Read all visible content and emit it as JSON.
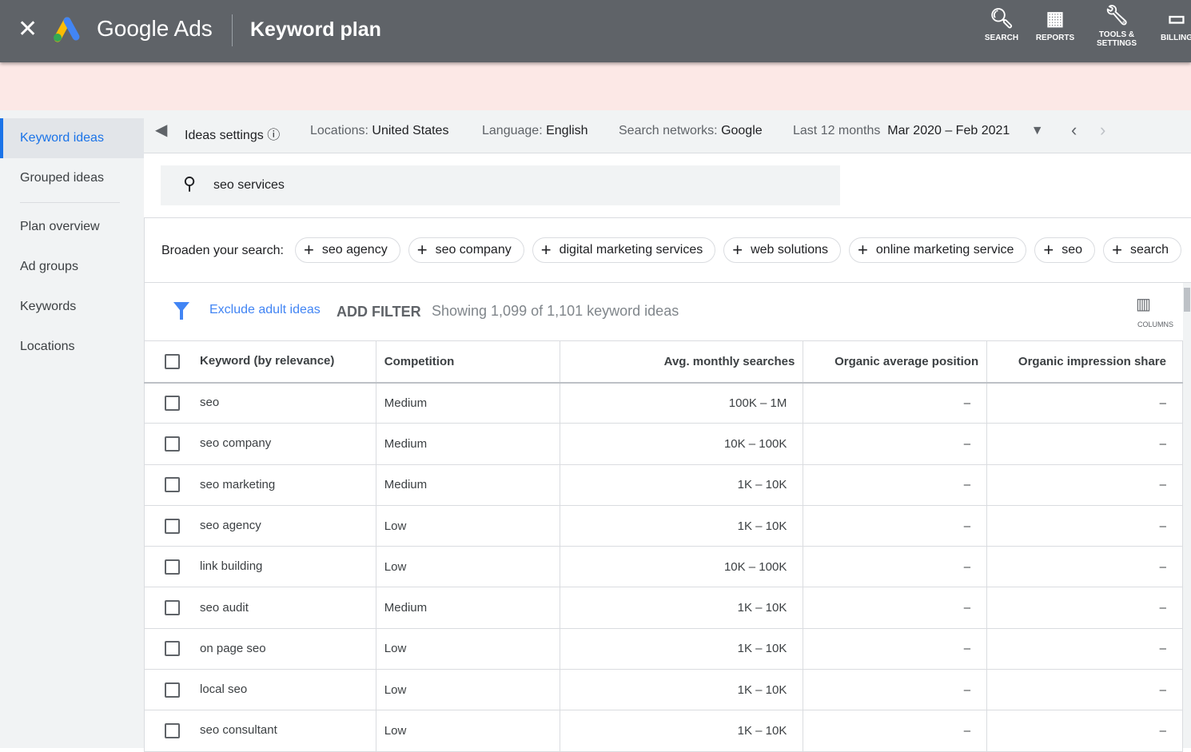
{
  "header": {
    "brand": "Google Ads",
    "title": "Keyword plan",
    "nav": [
      {
        "label": "SEARCH",
        "icon": "search-icon"
      },
      {
        "label": "REPORTS",
        "icon": "reports-icon"
      },
      {
        "label": "TOOLS & SETTINGS",
        "icon": "wrench-icon"
      },
      {
        "label": "BILLING",
        "icon": "credit-card-icon"
      }
    ]
  },
  "sidebar": {
    "items": [
      {
        "label": "Keyword ideas",
        "active": true
      },
      {
        "label": "Grouped ideas"
      },
      {
        "label": "Plan overview"
      },
      {
        "label": "Ad groups"
      },
      {
        "label": "Keywords"
      },
      {
        "label": "Locations"
      }
    ]
  },
  "settings": {
    "ideas": "Ideas settings",
    "locations_label": "Locations:",
    "locations": "United States",
    "language_label": "Language:",
    "language": "English",
    "networks_label": "Search networks:",
    "networks": "Google",
    "period_label": "Last 12 months",
    "period": "Mar 2020 – Feb 2021"
  },
  "search": {
    "value": "seo services"
  },
  "broaden": {
    "label": "Broaden your search:",
    "chips": [
      "seo agency",
      "seo company",
      "digital marketing services",
      "web solutions",
      "online marketing service",
      "seo",
      "search"
    ]
  },
  "filter": {
    "exclude": "Exclude adult ideas",
    "add": "ADD FILTER",
    "showing": "Showing 1,099 of 1,101 keyword ideas",
    "columns": "COLUMNS"
  },
  "table": {
    "headers": [
      "Keyword (by relevance)",
      "Competition",
      "Avg. monthly searches",
      "Organic average position",
      "Organic impression share"
    ],
    "rows": [
      [
        "seo",
        "Medium",
        "100K – 1M",
        "–",
        "–"
      ],
      [
        "seo company",
        "Medium",
        "10K – 100K",
        "–",
        "–"
      ],
      [
        "seo marketing",
        "Medium",
        "1K – 10K",
        "–",
        "–"
      ],
      [
        "seo agency",
        "Low",
        "1K – 10K",
        "–",
        "–"
      ],
      [
        "link building",
        "Low",
        "10K – 100K",
        "–",
        "–"
      ],
      [
        "seo audit",
        "Medium",
        "1K – 10K",
        "–",
        "–"
      ],
      [
        "on page seo",
        "Low",
        "1K – 10K",
        "–",
        "–"
      ],
      [
        "local seo",
        "Low",
        "1K – 10K",
        "–",
        "–"
      ],
      [
        "seo consultant",
        "Low",
        "1K – 10K",
        "–",
        "–"
      ]
    ]
  }
}
